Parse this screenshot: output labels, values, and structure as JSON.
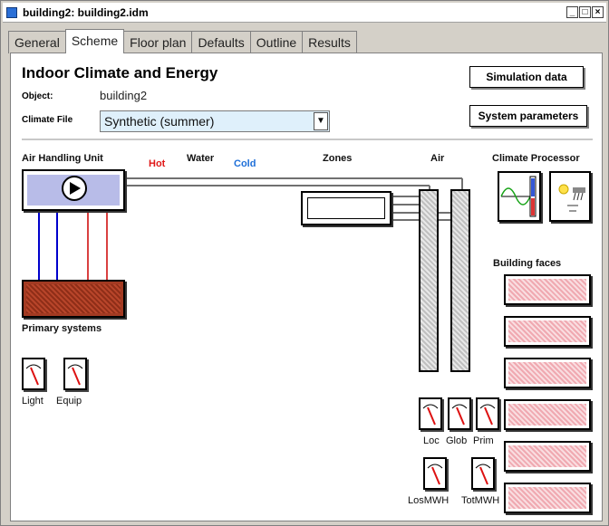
{
  "window": {
    "title": "building2: building2.idm",
    "controls": {
      "minimize": "_",
      "maximize": "□",
      "close": "×"
    }
  },
  "tabs": [
    {
      "label": "General",
      "active": false
    },
    {
      "label": "Scheme",
      "active": true
    },
    {
      "label": "Floor plan",
      "active": false
    },
    {
      "label": "Defaults",
      "active": false
    },
    {
      "label": "Outline",
      "active": false
    },
    {
      "label": "Results",
      "active": false
    }
  ],
  "header": {
    "title": "Indoor Climate and Energy",
    "object_label": "Object:",
    "object_value": "building2",
    "climate_label": "Climate File",
    "climate_value": "Synthetic (summer)",
    "simulation_button": "Simulation data",
    "system_button": "System parameters"
  },
  "scheme": {
    "ahu_label": "Air Handling Unit",
    "hot_label": "Hot",
    "water_label": "Water",
    "cold_label": "Cold",
    "zones_label": "Zones",
    "air_label": "Air",
    "climate_processor_label": "Climate Processor",
    "building_faces_label": "Building faces",
    "primary_systems_label": "Primary systems"
  },
  "meters": {
    "light": "Light",
    "equip": "Equip",
    "loc": "Loc",
    "glob": "Glob",
    "prim": "Prim",
    "losmwh": "LosMWH",
    "totmwh": "TotMWH"
  },
  "colors": {
    "hot": "#e01818",
    "cold": "#1e6fd8",
    "water_supply": "#0000cc",
    "water_return": "#cc0000"
  },
  "icons": {
    "fan": "fan-icon",
    "climate_graph": "climate-graph-icon",
    "sun_weather": "sun-weather-icon",
    "dropdown": "chevron-down-icon"
  }
}
